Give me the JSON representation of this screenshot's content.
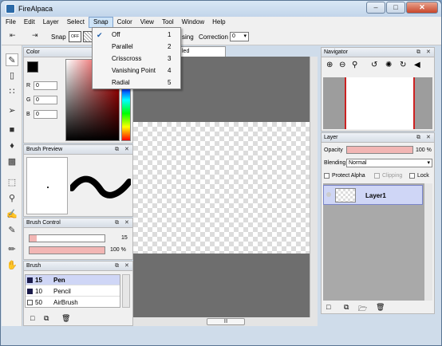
{
  "window": {
    "title": "FireAlpaca",
    "minimize": "–",
    "maximize": "□",
    "close": "✕"
  },
  "menubar": [
    "File",
    "Edit",
    "Layer",
    "Select",
    "Snap",
    "Color",
    "View",
    "Tool",
    "Window",
    "Help"
  ],
  "toolbar": {
    "back_icon": "⇤",
    "forward_icon": "⇥",
    "snap_label": "Snap",
    "snap_off": "OFF",
    "antialias_partial": "sing",
    "correction_label": "Correction",
    "correction_value": "0"
  },
  "snap_menu": [
    {
      "label": "Off",
      "key": "1",
      "checked": true
    },
    {
      "label": "Parallel",
      "key": "2"
    },
    {
      "label": "Crisscross",
      "key": "3"
    },
    {
      "label": "Vanishing Point",
      "key": "4"
    },
    {
      "label": "Radial",
      "key": "5"
    }
  ],
  "doc_tab": "led",
  "color_panel": {
    "title": "Color",
    "r_label": "R",
    "r": "0",
    "g_label": "G",
    "g": "0",
    "b_label": "B",
    "b": "0"
  },
  "brush_preview": {
    "title": "Brush Preview"
  },
  "brush_control": {
    "title": "Brush Control",
    "size": "15",
    "opacity": "100 %",
    "size_fill": 0.1,
    "opacity_fill": 1.0
  },
  "brush": {
    "title": "Brush",
    "items": [
      {
        "size": "15",
        "name": "Pen"
      },
      {
        "size": "10",
        "name": "Pencil"
      },
      {
        "size": "50",
        "name": "AirBrush"
      }
    ]
  },
  "navigator": {
    "title": "Navigator"
  },
  "layer_panel": {
    "title": "Layer",
    "opacity_label": "Opacity",
    "opacity_value": "100 %",
    "opacity_fill": 1.0,
    "blending_label": "Blending",
    "blending_value": "Normal",
    "protect_alpha": "Protect Alpha",
    "clipping": "Clipping",
    "lock": "Lock",
    "layer_name": "Layer1"
  },
  "colors": {
    "accent_pink": "#f2b6b4",
    "selection": "#cfd6f6",
    "titlebar": "#c9daf0"
  }
}
